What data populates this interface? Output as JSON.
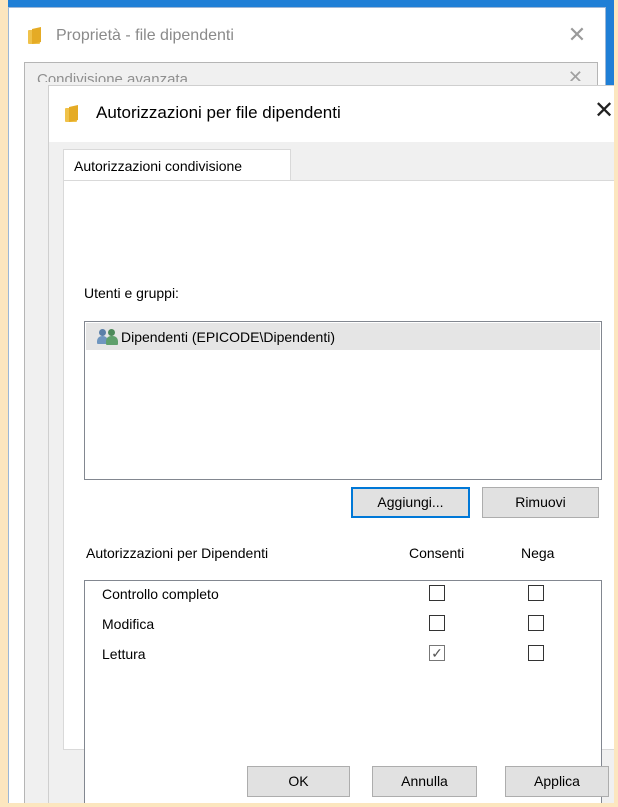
{
  "background_window": {
    "title": "Proprietà - file dipendenti",
    "close_glyph": "✕"
  },
  "middle_window": {
    "title": "Condivisione avanzata",
    "close_glyph": "✕"
  },
  "dialog": {
    "title": "Autorizzazioni per file dipendenti",
    "close_glyph": "✕",
    "tab_label": "Autorizzazioni condivisione",
    "users_label": "Utenti e gruppi:",
    "users": [
      {
        "name": "Dipendenti (EPICODE\\Dipendenti)",
        "icon": "users-group-icon",
        "selected": true
      }
    ],
    "add_button": "Aggiungi...",
    "remove_button": "Rimuovi",
    "permissions_header": "Autorizzazioni per Dipendenti",
    "col_allow": "Consenti",
    "col_deny": "Nega",
    "permissions": [
      {
        "name": "Controllo completo",
        "allow": false,
        "deny": false
      },
      {
        "name": "Modifica",
        "allow": false,
        "deny": false
      },
      {
        "name": "Lettura",
        "allow": true,
        "deny": false
      }
    ],
    "ok_button": "OK",
    "cancel_button": "Annulla",
    "apply_button": "Applica"
  },
  "colors": {
    "backdrop_blue": "#1f7fd6",
    "frame_peach": "#fce6bf",
    "dialog_bg": "#f0f0f0",
    "focus_blue": "#0078d7"
  }
}
